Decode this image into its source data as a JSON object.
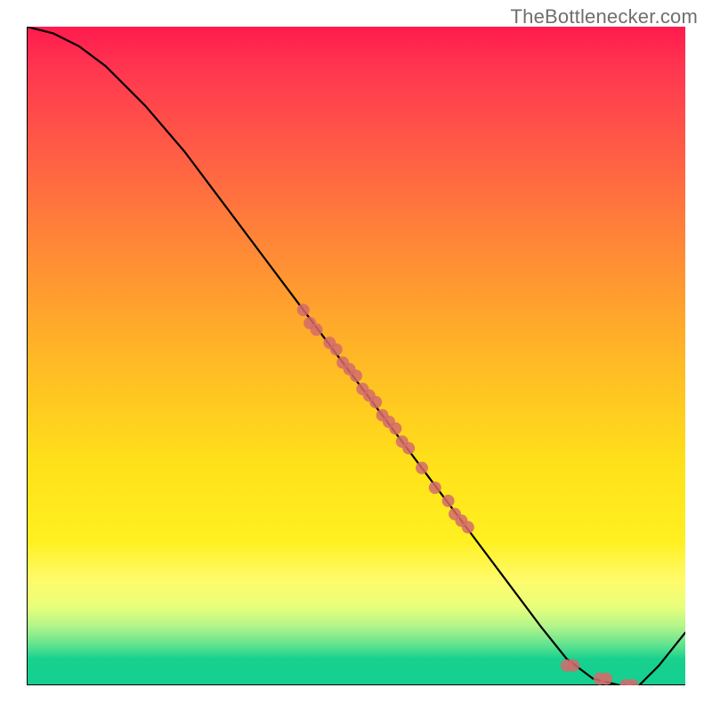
{
  "watermark": "TheBottlenecker.com",
  "chart_data": {
    "type": "line",
    "title": "",
    "xlabel": "",
    "ylabel": "",
    "xlim": [
      0,
      100
    ],
    "ylim": [
      0,
      100
    ],
    "grid": false,
    "series": [
      {
        "name": "curve",
        "x": [
          0,
          4,
          8,
          12,
          18,
          24,
          30,
          36,
          42,
          48,
          54,
          60,
          66,
          72,
          78,
          82,
          86,
          90,
          93,
          96,
          100
        ],
        "y": [
          100,
          99,
          97,
          94,
          88,
          81,
          73,
          65,
          57,
          49,
          41,
          33,
          25,
          17,
          9,
          4,
          1,
          0,
          0,
          3,
          8
        ]
      }
    ],
    "points": {
      "name": "markers",
      "x": [
        42,
        43,
        44,
        46,
        47,
        48,
        49,
        50,
        51,
        52,
        53,
        54,
        55,
        56,
        57,
        58,
        60,
        62,
        64,
        65,
        66,
        67,
        82,
        83,
        87,
        88,
        91,
        92
      ],
      "y": [
        57,
        55,
        54,
        52,
        51,
        49,
        48,
        47,
        45,
        44,
        43,
        41,
        40,
        39,
        37,
        36,
        33,
        30,
        28,
        26,
        25,
        24,
        3,
        3,
        1,
        1,
        0,
        0
      ]
    },
    "background_gradient_stops": [
      {
        "pos": 0.0,
        "color": "#ff1a4d"
      },
      {
        "pos": 0.5,
        "color": "#ffb726"
      },
      {
        "pos": 0.8,
        "color": "#fff020"
      },
      {
        "pos": 0.96,
        "color": "#18d18f"
      },
      {
        "pos": 1.0,
        "color": "#14cf90"
      }
    ]
  }
}
